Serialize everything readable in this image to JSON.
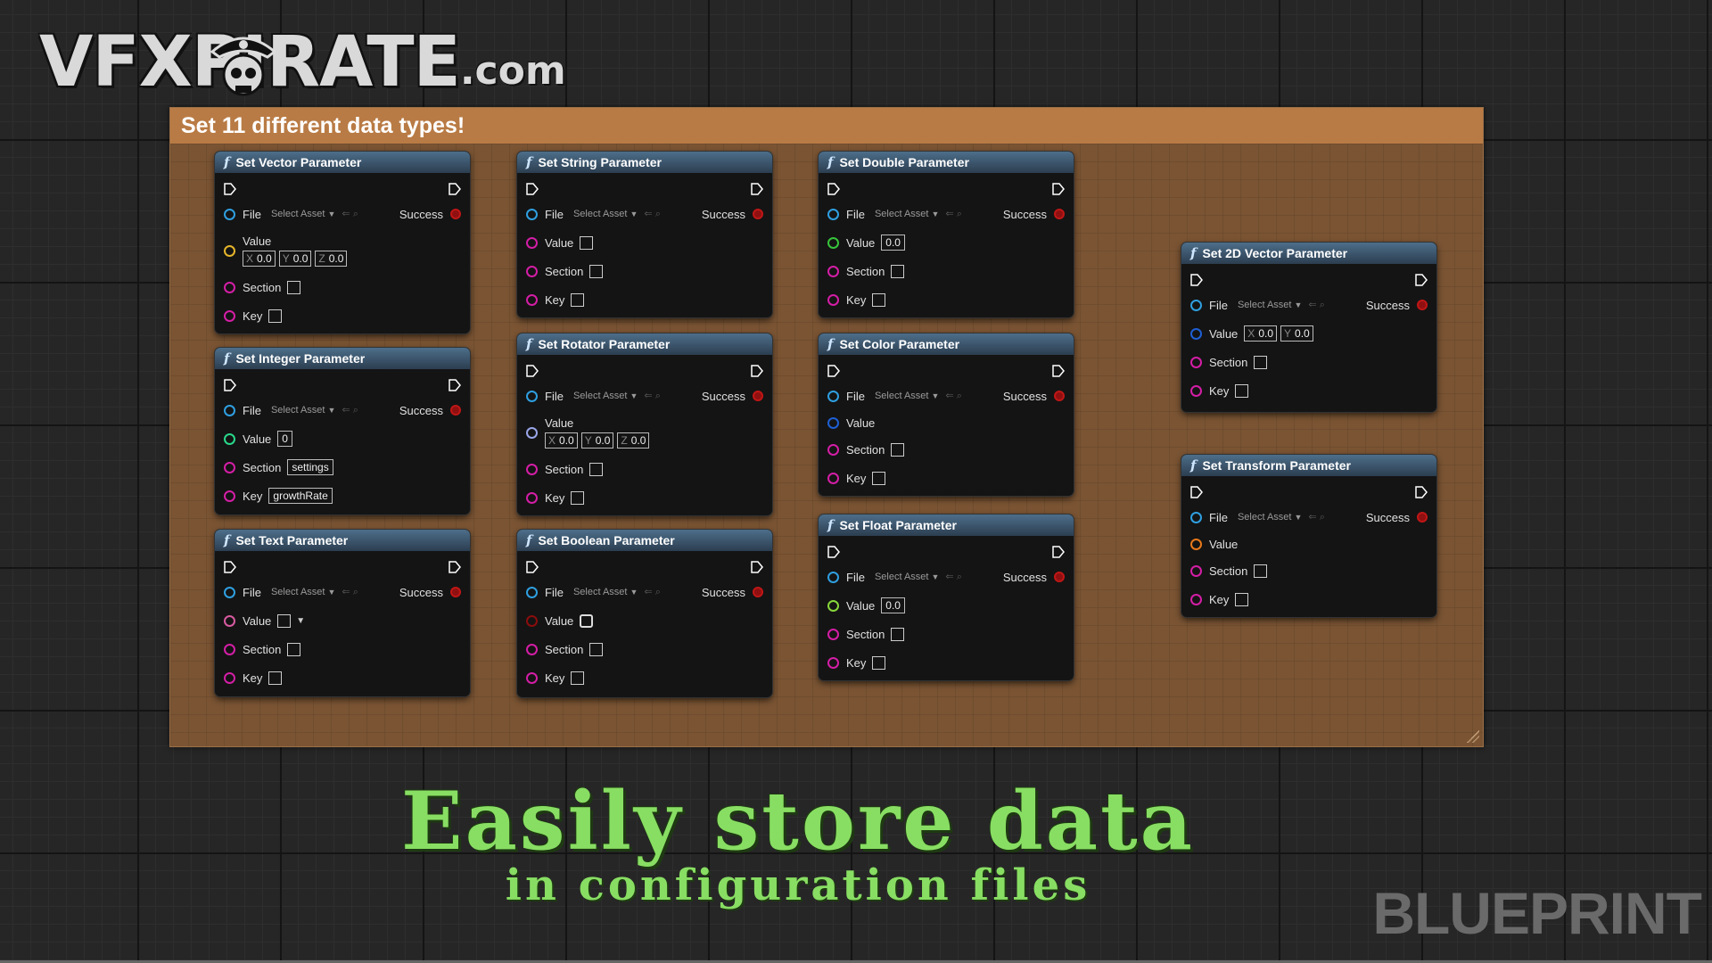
{
  "logo": {
    "main": "VFXPIRATE",
    "domain": ".com"
  },
  "comment": {
    "title": "Set 11 different data types!"
  },
  "common": {
    "file": "File",
    "select_asset": "Select Asset",
    "success": "Success",
    "value": "Value",
    "section": "Section",
    "key": "Key",
    "x": "X",
    "y": "Y",
    "z": "Z",
    "zero": "0.0"
  },
  "nodes": {
    "vector": {
      "title": "Set Vector Parameter"
    },
    "string": {
      "title": "Set String Parameter"
    },
    "double": {
      "title": "Set Double Parameter",
      "value": "0.0"
    },
    "vector2d": {
      "title": "Set 2D Vector Parameter"
    },
    "integer": {
      "title": "Set Integer Parameter",
      "value": "0",
      "section": "settings",
      "key": "growthRate"
    },
    "rotator": {
      "title": "Set Rotator Parameter"
    },
    "color": {
      "title": "Set Color Parameter"
    },
    "transform": {
      "title": "Set Transform Parameter"
    },
    "text": {
      "title": "Set Text Parameter"
    },
    "boolean": {
      "title": "Set Boolean Parameter"
    },
    "float": {
      "title": "Set Float Parameter",
      "value": "0.0"
    }
  },
  "pin_colors": {
    "file": "#2f9fe0",
    "vector": "#e5b52a",
    "string": "#d41ea6",
    "double": "#37c43b",
    "integer": "#28d88a",
    "rotator": "#9aa6e8",
    "color": "#1e5fd4",
    "transform": "#e8791a",
    "text": "#d85aa0",
    "boolean": "#8b0d0d",
    "float": "#88d63b",
    "section": "#d41ea6",
    "key": "#d41ea6"
  },
  "hero": {
    "line1": "Easily store data",
    "line2": "in configuration files"
  },
  "watermark": "BLUEPRINT"
}
